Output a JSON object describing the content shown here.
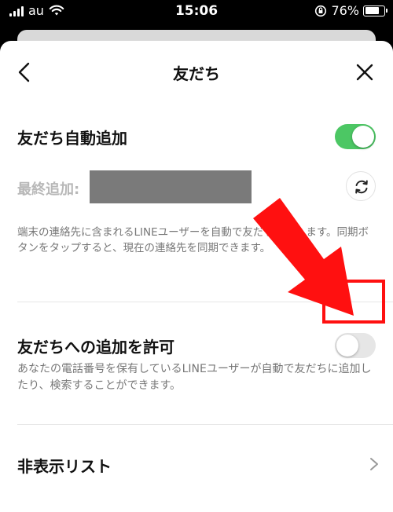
{
  "status_bar": {
    "carrier": "au",
    "time": "15:06",
    "battery_percent": "76%",
    "battery_level": 0.76
  },
  "nav": {
    "title": "友だち",
    "back_icon": "chevron-left-icon",
    "close_icon": "close-icon"
  },
  "auto_add": {
    "title": "友だち自動追加",
    "toggle_on": true,
    "last_added_label": "最終追加:",
    "sync_icon": "sync-icon",
    "description": "端末の連絡先に含まれるLINEユーザーを自動で友だち追加します。同期ボタンをタップすると、現在の連絡先を同期できます。"
  },
  "allow_add": {
    "title": "友だちへの追加を許可",
    "toggle_on": false,
    "description": "あなたの電話番号を保有しているLINEユーザーが自動で友だちに追加したり、検索することができます。"
  },
  "hidden_list": {
    "label": "非表示リスト",
    "chevron_icon": "chevron-right-icon"
  },
  "colors": {
    "toggle_on": "#4cc764",
    "toggle_off": "#e6e6e6",
    "highlight": "#ff1010"
  }
}
